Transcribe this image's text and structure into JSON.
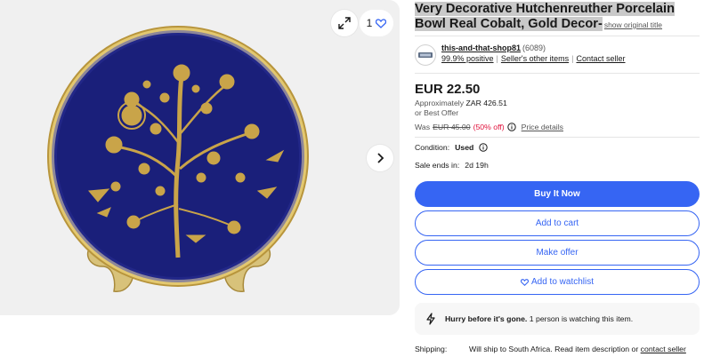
{
  "gallery": {
    "image_alt": "Cobalt blue porcelain plate with gold tree of life decor on gold stand",
    "watch_count": "1",
    "colors": {
      "background": "#f0f0f0",
      "cobalt": "#1a1f7a",
      "gold": "#c9a449"
    }
  },
  "listing": {
    "title_highlighted": "Very Decorative Hutchenreuther Porcelain Bowl Real Cobalt, Gold Decor-",
    "show_original_title": "show original title"
  },
  "seller": {
    "name": "this-and-that-shop81",
    "feedback_count": "(6089)",
    "positive": "99.9% positive",
    "other_items": "Seller's other items",
    "contact": "Contact seller"
  },
  "pricing": {
    "price": "EUR 22.50",
    "approx_label": "Approximately",
    "approx_value": "ZAR 426.51",
    "best_offer": "or Best Offer",
    "was_label": "Was",
    "was_price": "EUR 45.00",
    "discount": "(50% off)",
    "price_details": "Price details"
  },
  "condition": {
    "label": "Condition:",
    "value": "Used"
  },
  "sale": {
    "label": "Sale ends in:",
    "value": "2d 19h"
  },
  "actions": {
    "buy_now": "Buy It Now",
    "add_to_cart": "Add to cart",
    "make_offer": "Make offer",
    "add_to_watchlist": "Add to watchlist",
    "colors": {
      "primary": "#3665f3"
    }
  },
  "urgency": {
    "bold": "Hurry before it's gone.",
    "text": "1 person is watching this item."
  },
  "shipping": {
    "label": "Shipping:",
    "text": "Will ship to South Africa. Read item description or",
    "link": "contact seller"
  }
}
